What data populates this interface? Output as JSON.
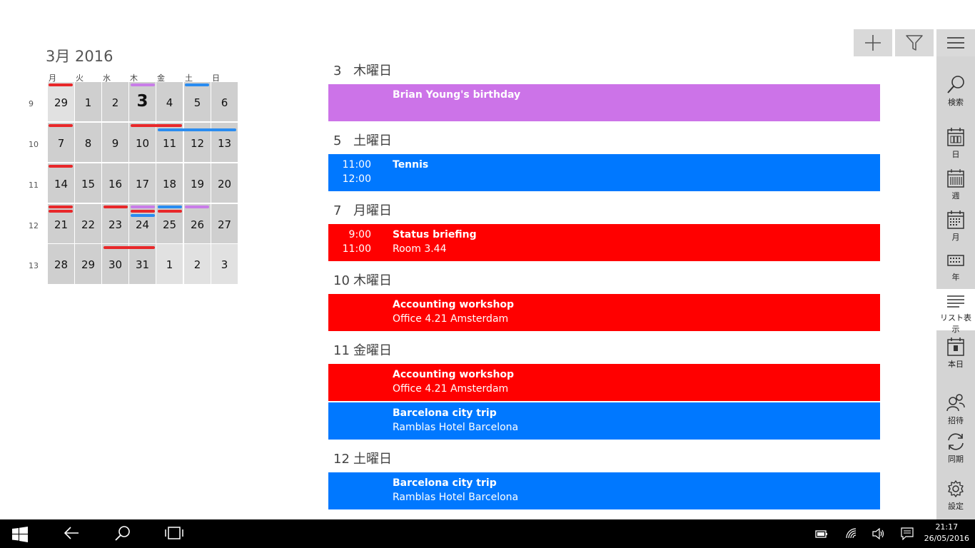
{
  "calendar": {
    "month_title": "3月 2016",
    "weekdays": [
      "月",
      "火",
      "水",
      "木",
      "金",
      "土",
      "日"
    ],
    "weeks": [
      {
        "num": "9",
        "days": [
          {
            "d": "29",
            "light": false,
            "outside": true
          },
          {
            "d": "1"
          },
          {
            "d": "2"
          },
          {
            "d": "3",
            "today": true
          },
          {
            "d": "4"
          },
          {
            "d": "5"
          },
          {
            "d": "6"
          }
        ]
      },
      {
        "num": "10",
        "days": [
          {
            "d": "7"
          },
          {
            "d": "8"
          },
          {
            "d": "9"
          },
          {
            "d": "10"
          },
          {
            "d": "11"
          },
          {
            "d": "12"
          },
          {
            "d": "13"
          }
        ]
      },
      {
        "num": "11",
        "days": [
          {
            "d": "14"
          },
          {
            "d": "15"
          },
          {
            "d": "16"
          },
          {
            "d": "17"
          },
          {
            "d": "18"
          },
          {
            "d": "19"
          },
          {
            "d": "20"
          }
        ]
      },
      {
        "num": "12",
        "days": [
          {
            "d": "21"
          },
          {
            "d": "22"
          },
          {
            "d": "23"
          },
          {
            "d": "24"
          },
          {
            "d": "25"
          },
          {
            "d": "26"
          },
          {
            "d": "27"
          }
        ]
      },
      {
        "num": "13",
        "days": [
          {
            "d": "28"
          },
          {
            "d": "29"
          },
          {
            "d": "30"
          },
          {
            "d": "31"
          },
          {
            "d": "1",
            "outside": true
          },
          {
            "d": "2",
            "outside": true
          },
          {
            "d": "3",
            "outside": true
          }
        ]
      }
    ],
    "colors": {
      "red": "#e8282a",
      "blue": "#2a8cf0",
      "purple": "#c87de8"
    }
  },
  "agenda": [
    {
      "day_num": "3",
      "day_name": "木曜日",
      "events": [
        {
          "color": "#cc73e8",
          "time_start": "",
          "time_end": "",
          "title": "Brian Young's birthday",
          "sub": ""
        }
      ]
    },
    {
      "day_num": "5",
      "day_name": "土曜日",
      "events": [
        {
          "color": "#0078ff",
          "time_start": "11:00",
          "time_end": "12:00",
          "title": "Tennis",
          "sub": ""
        }
      ]
    },
    {
      "day_num": "7",
      "day_name": "月曜日",
      "events": [
        {
          "color": "#ff0000",
          "time_start": "9:00",
          "time_end": "11:00",
          "title": "Status briefing",
          "sub": "Room 3.44"
        }
      ]
    },
    {
      "day_num": "10",
      "day_name": "木曜日",
      "events": [
        {
          "color": "#ff0000",
          "time_start": "",
          "time_end": "",
          "title": "Accounting workshop",
          "sub": "Office 4.21 Amsterdam"
        }
      ]
    },
    {
      "day_num": "11",
      "day_name": "金曜日",
      "events": [
        {
          "color": "#ff0000",
          "time_start": "",
          "time_end": "",
          "title": "Accounting workshop",
          "sub": "Office 4.21 Amsterdam"
        },
        {
          "color": "#0078ff",
          "time_start": "",
          "time_end": "",
          "title": "Barcelona city trip",
          "sub": "Ramblas Hotel Barcelona"
        }
      ]
    },
    {
      "day_num": "12",
      "day_name": "土曜日",
      "events": [
        {
          "color": "#0078ff",
          "time_start": "",
          "time_end": "",
          "title": "Barcelona city trip",
          "sub": "Ramblas Hotel Barcelona"
        }
      ]
    }
  ],
  "toolbar": {
    "add_icon": "plus-icon",
    "filter_icon": "filter-icon",
    "menu_icon": "hamburger-icon"
  },
  "nav": [
    {
      "id": "search",
      "label": "検索",
      "icon": "search-icon"
    },
    {
      "id": "day",
      "label": "日",
      "icon": "day-view-icon"
    },
    {
      "id": "week",
      "label": "週",
      "icon": "week-view-icon"
    },
    {
      "id": "month",
      "label": "月",
      "icon": "month-view-icon"
    },
    {
      "id": "year",
      "label": "年",
      "icon": "year-view-icon"
    },
    {
      "id": "list",
      "label": "リスト表示",
      "icon": "list-view-icon",
      "active": true
    },
    {
      "id": "today",
      "label": "本日",
      "icon": "today-icon"
    },
    {
      "id": "invite",
      "label": "招待",
      "icon": "invite-icon"
    },
    {
      "id": "sync",
      "label": "同期",
      "icon": "sync-icon"
    },
    {
      "id": "settings",
      "label": "設定",
      "icon": "gear-icon"
    }
  ],
  "taskbar": {
    "time": "21:17",
    "date": "26/05/2016"
  }
}
